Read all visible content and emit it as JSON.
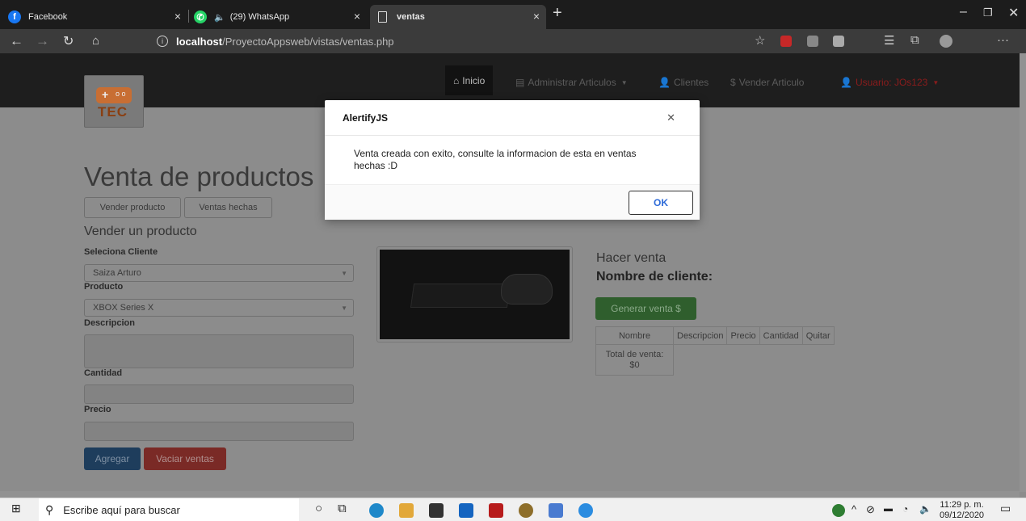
{
  "browser": {
    "tabs": [
      {
        "title": "Facebook",
        "icon": "facebook-icon",
        "color": "#1877f2"
      },
      {
        "title": "(29) WhatsApp",
        "icon": "whatsapp-icon",
        "color": "#25d366"
      },
      {
        "title": "ventas",
        "icon": "page-icon"
      }
    ],
    "url_host": "localhost",
    "url_path": "/ProyectoAppsweb/vistas/ventas.php"
  },
  "navbar": {
    "inicio": "Inicio",
    "administrar": "Administrar Articulos",
    "clientes": "Clientes",
    "vender": "Vender Articulo",
    "usuario": "Usuario: JOs123"
  },
  "logo_text": "TEC",
  "page": {
    "title": "Venta de productos",
    "btn_vender": "Vender producto",
    "btn_ventas": "Ventas hechas",
    "subtitle": "Vender un producto",
    "label_cliente": "Seleciona Cliente",
    "cliente_value": "Saiza Arturo",
    "label_producto": "Producto",
    "producto_value": "XBOX Series X",
    "label_descripcion": "Descripcion",
    "label_cantidad": "Cantidad",
    "label_precio": "Precio",
    "btn_agregar": "Agregar",
    "btn_vaciar": "Vaciar ventas",
    "hacer_venta": "Hacer venta",
    "nombre_cliente": "Nombre de cliente:",
    "btn_generar": "Generar venta $",
    "table_headers": [
      "Nombre",
      "Descripcion",
      "Precio",
      "Cantidad",
      "Quitar"
    ],
    "total_label": "Total de venta:",
    "total_value": "$0"
  },
  "modal": {
    "title": "AlertifyJS",
    "message": "Venta creada con exito, consulte la informacion de esta en ventas hechas :D",
    "ok": "OK"
  },
  "taskbar": {
    "search_placeholder": "Escribe aquí para buscar",
    "time": "11:29 p. m.",
    "date": "09/12/2020"
  }
}
